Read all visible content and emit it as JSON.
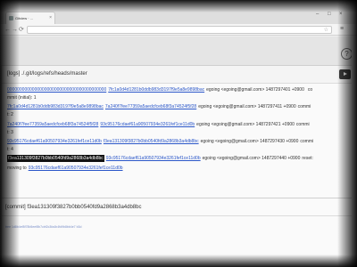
{
  "browser": {
    "tab_title": "Gitview · ...",
    "address": "",
    "window_controls": [
      "–",
      "□",
      "×"
    ]
  },
  "reflog": {
    "title": "[logs] ./.git/logs/refs/heads/master",
    "entries": [
      {
        "old": "0000000000000000000000000000000000000000",
        "new": "7fc1a0d4d1281b0ddb983d3197f9e5a8e9898bac",
        "meta": "egoing <egoing@gmail.com> 1487297401 +0900",
        "msg1": "co",
        "msg2": "mmit (initial): 1"
      },
      {
        "old": "7fc1a0d4d1281b0ddb983d3197f9e5a8e9898bac",
        "new": "7a240f7fee77359a5aedcfceb68f3a74524f5f28",
        "meta": "egoing <egoing@gmail.com> 1487297411 +0900",
        "msg1": "commi",
        "msg2": "t: 2"
      },
      {
        "old": "7a240f7fee77359a5aedcfceb68f3a74524f5f28",
        "new": "93c95176cdaef61a90507934e3261fef1ce11d0b",
        "meta": "egoing <egoing@gmail.com> 1487297421 +0900",
        "msg1": "commi",
        "msg2": "t: 3"
      },
      {
        "old": "93c95176cdaef61a90507934e3261fef1ce11d0b",
        "new": "f3ea131309f3827b0bb0540fd9a2868b3a4db8bc",
        "meta": "egoing <egoing@gmail.com> 1487297430 +0900",
        "msg1": "commi",
        "msg2": "t: 4"
      },
      {
        "old": "f3ea131309f3827b0bb0540fd9a2868b3a4db8bc",
        "new": "93c95176cdaef61a90507934e3261fef1ce11d0b",
        "meta": "egoing <egoing@gmail.com> 1487297440 +0900",
        "msg1": "reset:",
        "msg2": "moving to",
        "msg2_hash": "93c95176cdaef61a90507934e3261fef1ce11d0b"
      }
    ]
  },
  "commit": {
    "title": "[commit] f3ea131309f3827b0bb0540fd9a2868b3a4db8bc",
    "sub": "tree 1d8b4ef8f78b5eef8b7cbf2c3fa4b4fd9b8bb4e7 b3d"
  },
  "icons": {
    "help": "?",
    "tab_close": "×",
    "star": "☆",
    "menu": "≡"
  },
  "colors": {
    "link": "#2b57c9",
    "selected_bg": "#111111",
    "play_button": "#3d3d3d"
  }
}
